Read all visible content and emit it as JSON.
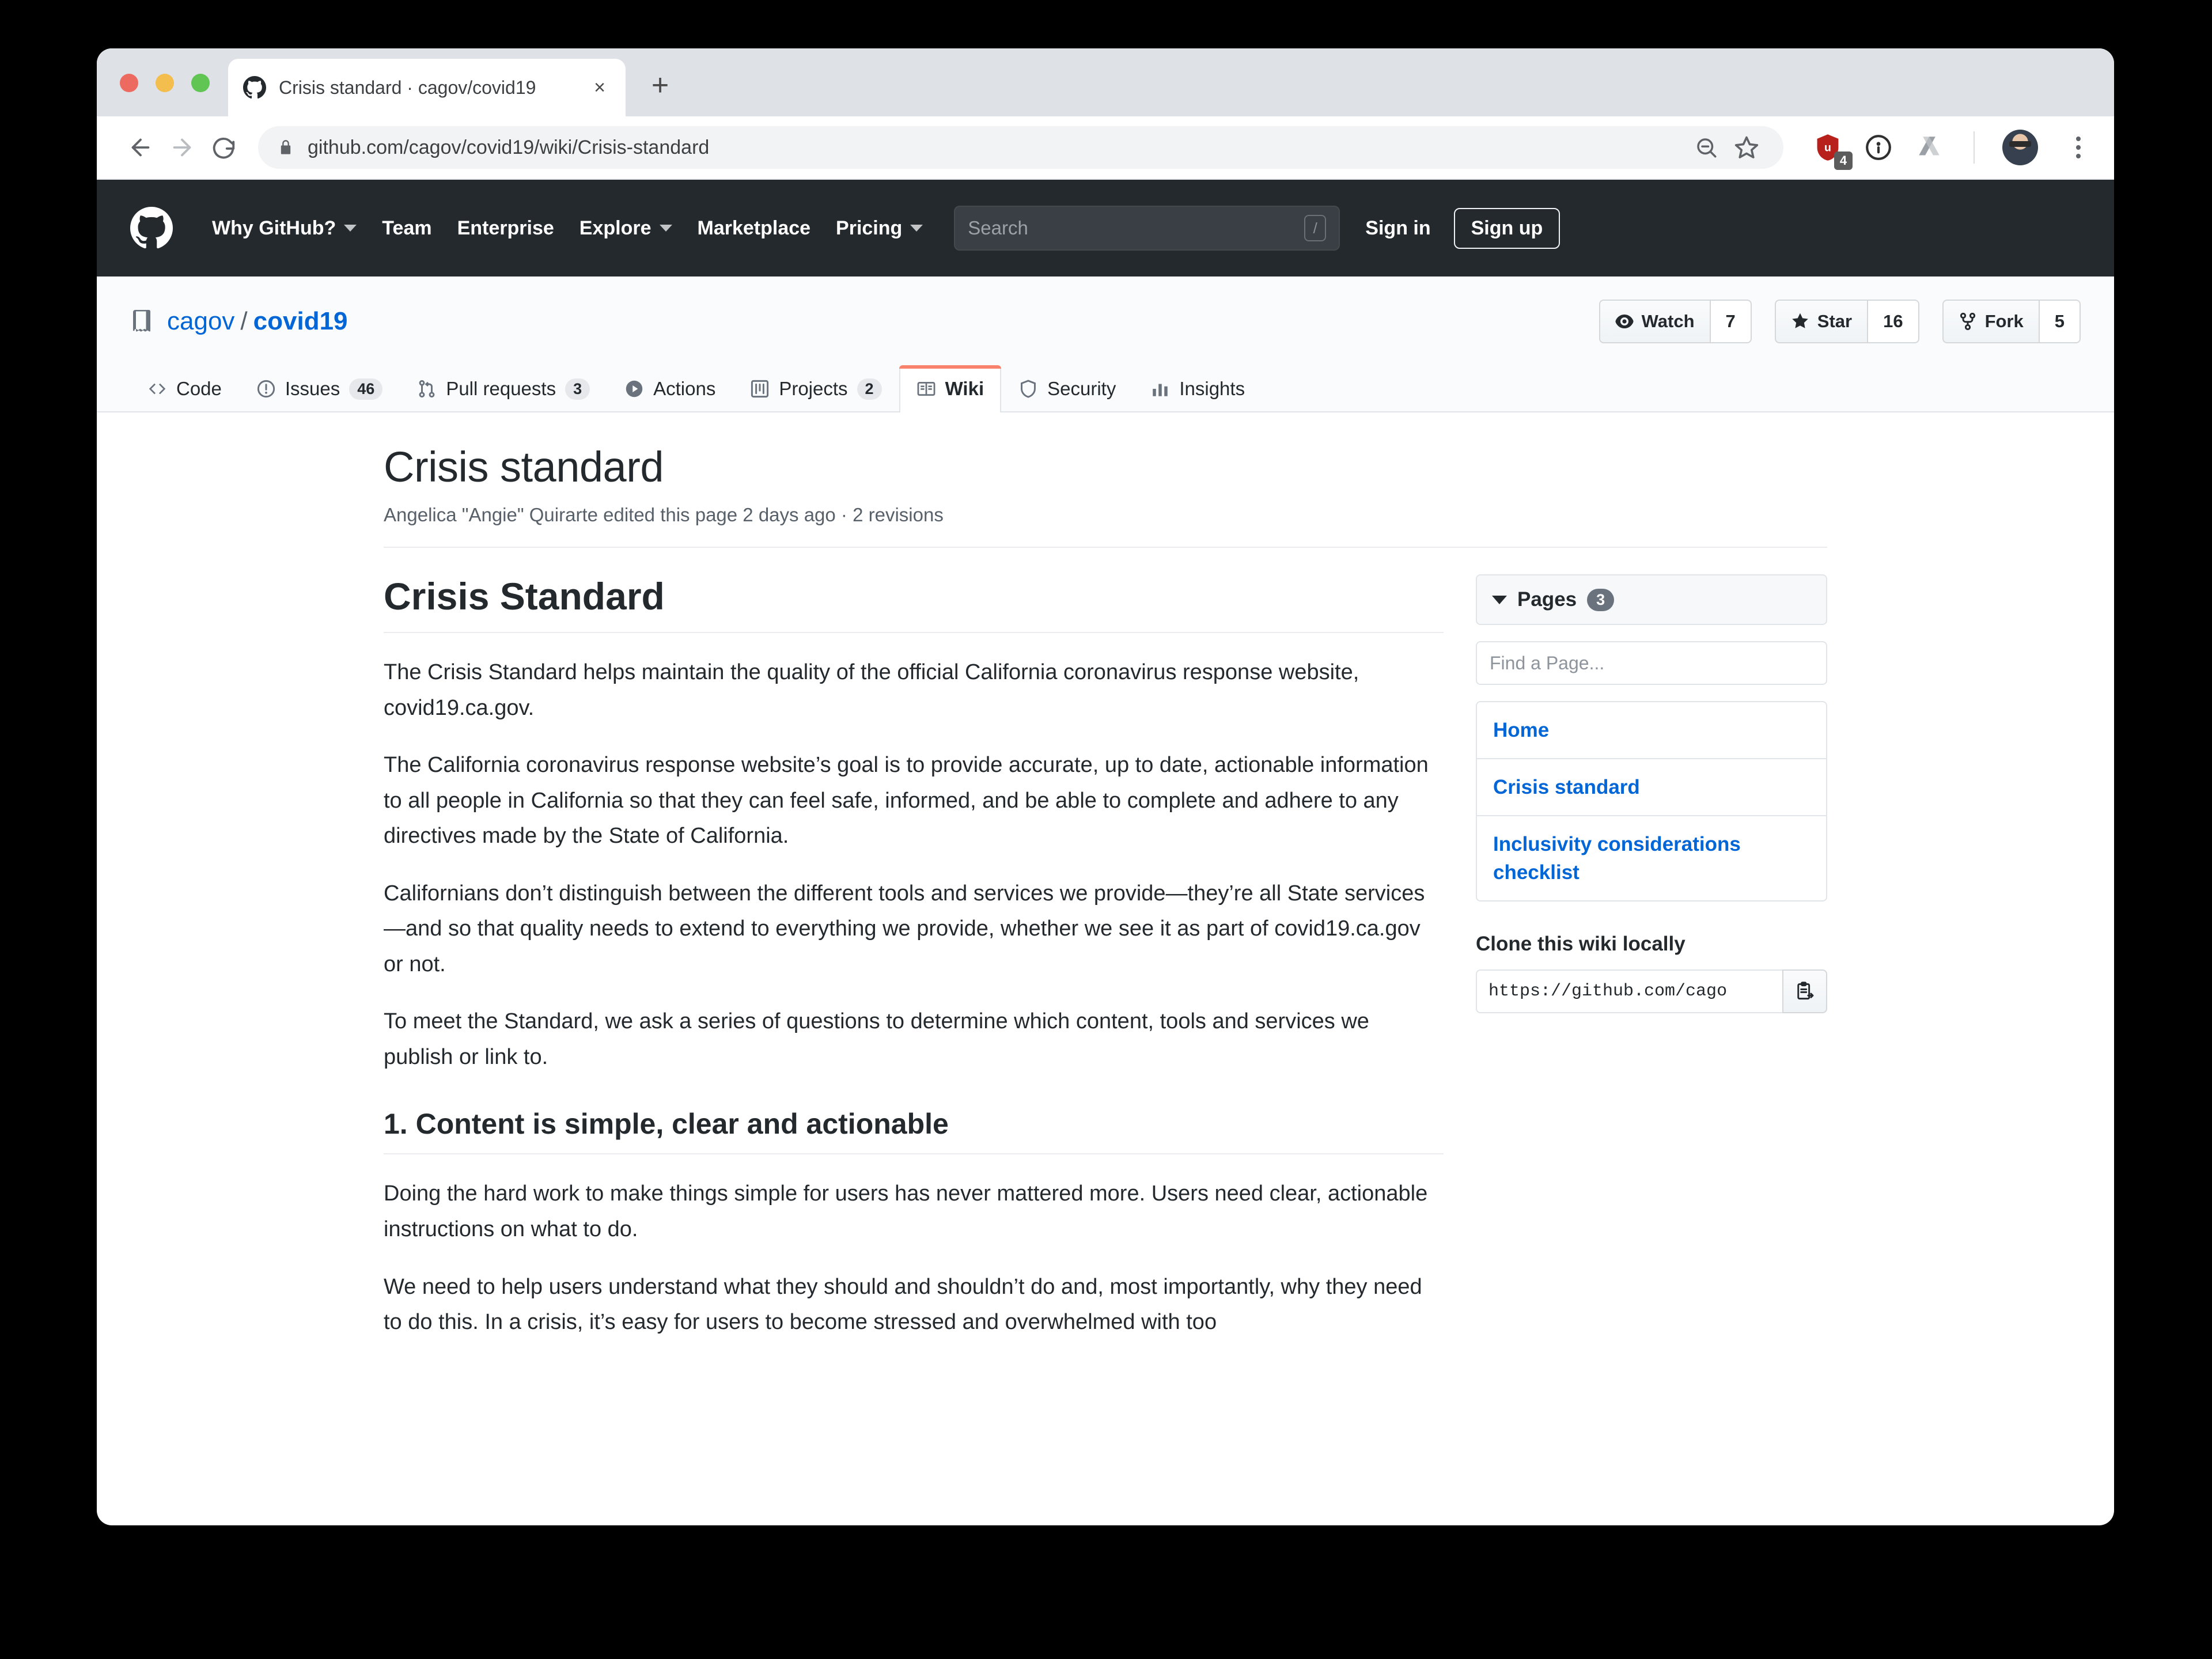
{
  "browser": {
    "tab": {
      "title": "Crisis standard · cagov/covid19",
      "favicon": "github-icon",
      "close": "×"
    },
    "new_tab": "+",
    "back": "←",
    "forward": "→",
    "reload": "⟳",
    "url": "github.com/cagov/covid19/wiki/Crisis-standard",
    "extensions": {
      "ublock_badge": "4"
    }
  },
  "gh_header": {
    "nav": [
      {
        "label": "Why GitHub?",
        "caret": true
      },
      {
        "label": "Team",
        "caret": false
      },
      {
        "label": "Enterprise",
        "caret": false
      },
      {
        "label": "Explore",
        "caret": true
      },
      {
        "label": "Marketplace",
        "caret": false
      },
      {
        "label": "Pricing",
        "caret": true
      }
    ],
    "search_placeholder": "Search",
    "search_key": "/",
    "sign_in": "Sign in",
    "sign_up": "Sign up"
  },
  "repo": {
    "owner": "cagov",
    "separator": "/",
    "name": "covid19",
    "actions": [
      {
        "label": "Watch",
        "count": "7",
        "icon": "eye-icon"
      },
      {
        "label": "Star",
        "count": "16",
        "icon": "star-icon"
      },
      {
        "label": "Fork",
        "count": "5",
        "icon": "fork-icon"
      }
    ],
    "tabs": [
      {
        "label": "Code",
        "count": "",
        "icon": "code-icon",
        "active": false
      },
      {
        "label": "Issues",
        "count": "46",
        "icon": "issue-opened-icon",
        "active": false
      },
      {
        "label": "Pull requests",
        "count": "3",
        "icon": "git-pull-request-icon",
        "active": false
      },
      {
        "label": "Actions",
        "count": "",
        "icon": "play-icon",
        "active": false
      },
      {
        "label": "Projects",
        "count": "2",
        "icon": "project-icon",
        "active": false
      },
      {
        "label": "Wiki",
        "count": "",
        "icon": "book-icon",
        "active": true
      },
      {
        "label": "Security",
        "count": "",
        "icon": "shield-icon",
        "active": false
      },
      {
        "label": "Insights",
        "count": "",
        "icon": "graph-icon",
        "active": false
      }
    ]
  },
  "wiki": {
    "page_title": "Crisis standard",
    "byline": "Angelica \"Angie\" Quirarte edited this page 2 days ago · 2 revisions",
    "heading": "Crisis Standard",
    "paragraphs": [
      "The Crisis Standard helps maintain the quality of the official California coronavirus response website, covid19.ca.gov.",
      "The California coronavirus response website’s goal is to provide accurate, up to date, actionable information to all people in California so that they can feel safe, informed, and be able to complete and adhere to any directives made by the State of California.",
      "Californians don’t distinguish between the different tools and services we provide—they’re all State services—and so that quality needs to extend to everything we provide, whether we see it as part of covid19.ca.gov or not.",
      "To meet the Standard, we ask a series of questions to determine which content, tools and services we publish or link to."
    ],
    "section_heading": "1. Content is simple, clear and actionable",
    "section_paragraphs": [
      "Doing the hard work to make things simple for users has never mattered more. Users need clear, actionable instructions on what to do.",
      "We need to help users understand what they should and shouldn’t do and, most importantly, why they need to do this. In a crisis, it’s easy for users to become stressed and overwhelmed with too"
    ]
  },
  "sidebar": {
    "pages_label": "Pages",
    "pages_count": "3",
    "find_placeholder": "Find a Page...",
    "pages": [
      {
        "label": "Home"
      },
      {
        "label": "Crisis standard"
      },
      {
        "label": "Inclusivity considerations checklist"
      }
    ],
    "clone_title": "Clone this wiki locally",
    "clone_url": "https://github.com/cago",
    "copy_icon": "clipboard-icon"
  },
  "colors": {
    "gh_header_bg": "#24292e",
    "link_blue": "#0366d6",
    "active_tab_accent": "#f9826c",
    "border": "#e1e4e8"
  }
}
